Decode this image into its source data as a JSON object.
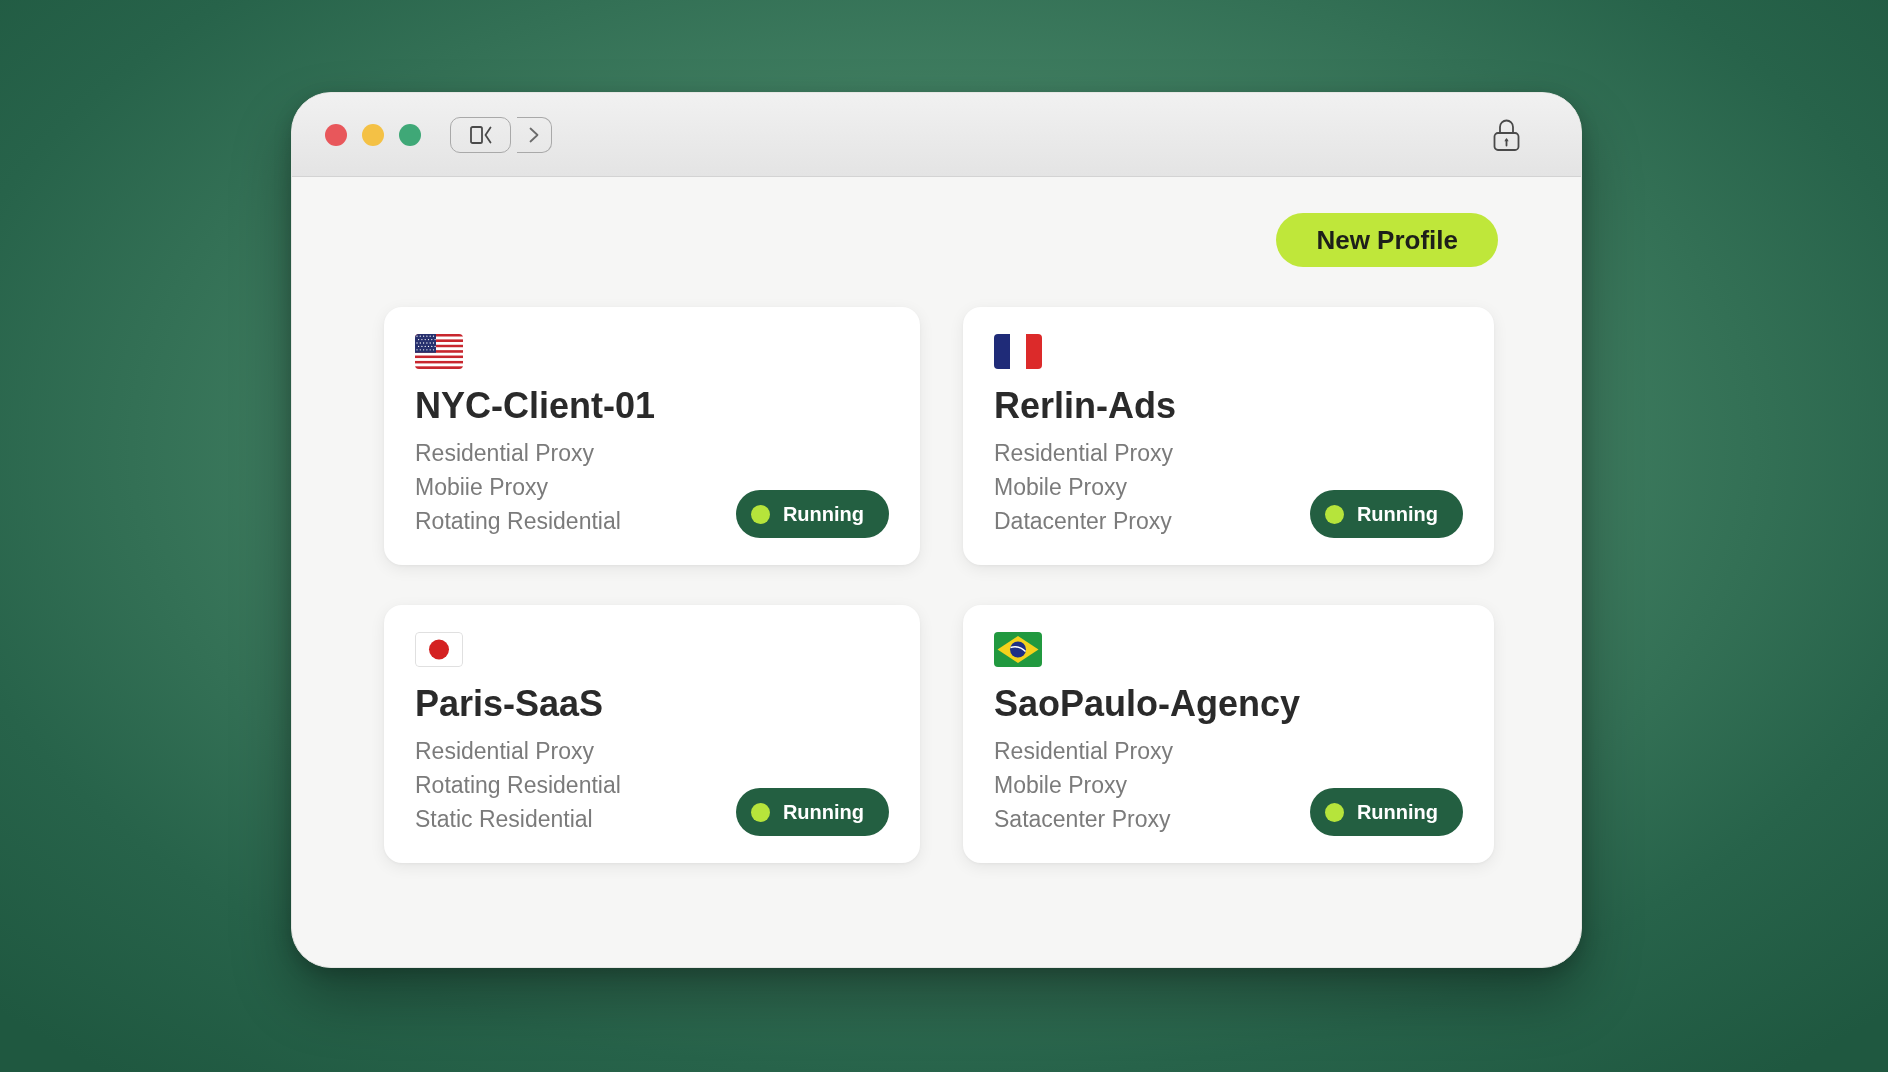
{
  "header": {
    "new_profile_button": "New Profile"
  },
  "profiles": [
    {
      "flag": {
        "kind": "us"
      },
      "name": "NYC-Client-01",
      "proxies": [
        "Residential Proxy",
        "Mobiie Proxy",
        "Rotating Residential"
      ],
      "status": {
        "label": "Running",
        "active": true
      }
    },
    {
      "flag": {
        "kind": "fr"
      },
      "name": "Rerlin-Ads",
      "proxies": [
        "Residential Proxy",
        "Mobile Proxy",
        "Datacenter Proxy"
      ],
      "status": {
        "label": "Running",
        "active": true
      }
    },
    {
      "flag": {
        "kind": "jp"
      },
      "name": "Paris-SaaS",
      "proxies": [
        "Residential Proxy",
        "Rotating Residential",
        "Static Residential"
      ],
      "status": {
        "label": "Running",
        "active": true
      }
    },
    {
      "flag": {
        "kind": "br"
      },
      "name": "SaoPaulo-Agency",
      "proxies": [
        "Residential Proxy",
        "Mobile Proxy",
        "Satacenter Proxy"
      ],
      "status": {
        "label": "Running",
        "active": true
      }
    }
  ]
}
